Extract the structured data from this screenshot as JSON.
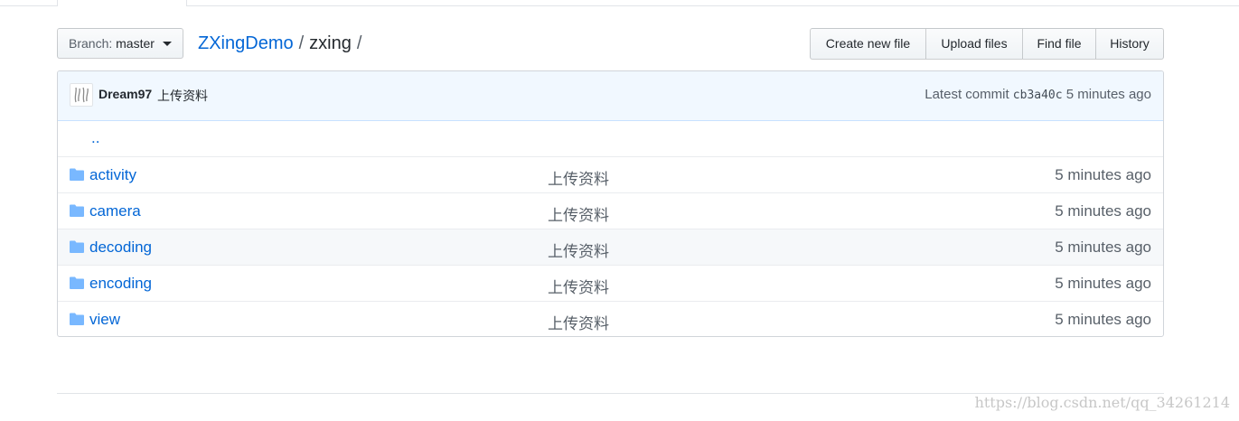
{
  "branch": {
    "label": "Branch:",
    "value": "master"
  },
  "breadcrumb": {
    "repo": "ZXingDemo",
    "separator": "/",
    "current": "zxing",
    "trailing": "/"
  },
  "toolbar": {
    "create_new_file": "Create new file",
    "upload_files": "Upload files",
    "find_file": "Find file",
    "history": "History"
  },
  "commit": {
    "author": "Dream97",
    "message": "上传资料",
    "latest_label": "Latest commit",
    "sha": "cb3a40c",
    "age": "5 minutes ago"
  },
  "parent_link": "..",
  "files": [
    {
      "name": "activity",
      "message": "上传资料",
      "age": "5 minutes ago",
      "icon": "folder-icon"
    },
    {
      "name": "camera",
      "message": "上传资料",
      "age": "5 minutes ago",
      "icon": "folder-icon"
    },
    {
      "name": "decoding",
      "message": "上传资料",
      "age": "5 minutes ago",
      "icon": "folder-icon"
    },
    {
      "name": "encoding",
      "message": "上传资料",
      "age": "5 minutes ago",
      "icon": "folder-icon"
    },
    {
      "name": "view",
      "message": "上传资料",
      "age": "5 minutes ago",
      "icon": "folder-icon"
    }
  ],
  "watermark": "https://blog.csdn.net/qq_34261214",
  "colors": {
    "link": "#0366d6",
    "folder": "#79b8ff",
    "commit_bg": "#f1f8ff"
  }
}
